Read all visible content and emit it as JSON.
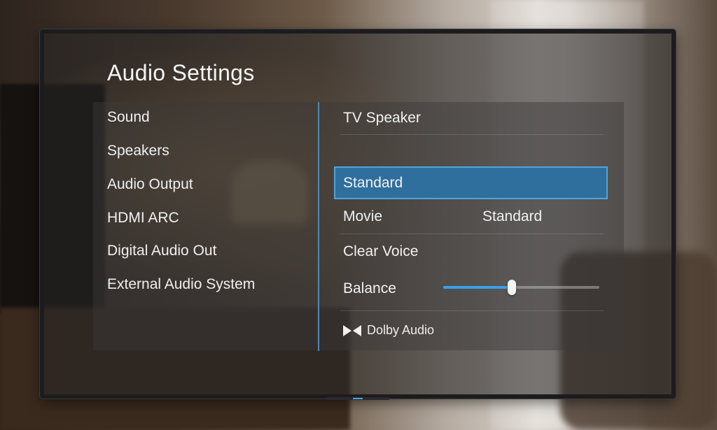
{
  "title": "Audio Settings",
  "menu": [
    {
      "label": "Sound"
    },
    {
      "label": "Speakers"
    },
    {
      "label": "Audio Output"
    },
    {
      "label": "HDMI ARC"
    },
    {
      "label": "Digital Audio Out"
    },
    {
      "label": "External Audio System"
    }
  ],
  "detail": {
    "header": "TV Speaker",
    "options": [
      {
        "label": "Standard",
        "selected": true
      },
      {
        "label": "Movie",
        "value": "Standard"
      },
      {
        "label": "Clear Voice"
      }
    ],
    "balance": {
      "label": "Balance",
      "level_percent": 44
    },
    "dolby": {
      "label": "Dolby Audio",
      "icon": "dolby-icon"
    }
  },
  "colors": {
    "accent": "#3a8fd0",
    "selected_bg": "#2f6f9e",
    "text": "#f2f2f2"
  }
}
